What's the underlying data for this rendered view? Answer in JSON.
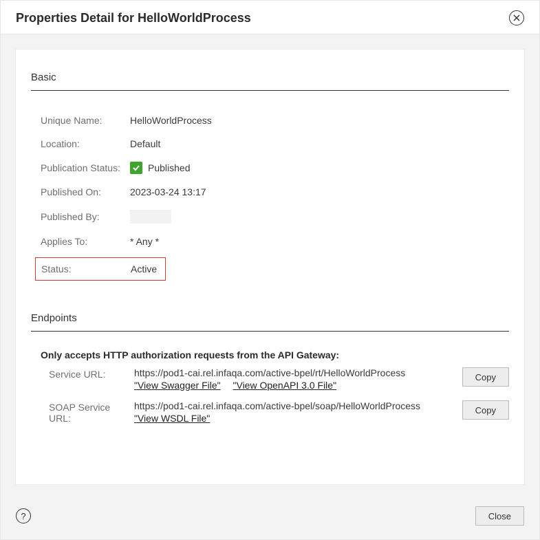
{
  "header": {
    "title": "Properties Detail for HelloWorldProcess"
  },
  "basic": {
    "section_title": "Basic",
    "unique_name_label": "Unique Name:",
    "unique_name_value": "HelloWorldProcess",
    "location_label": "Location:",
    "location_value": "Default",
    "pub_status_label": "Publication Status:",
    "pub_status_value": "Published",
    "published_on_label": "Published On:",
    "published_on_value": "2023-03-24 13:17",
    "published_by_label": "Published By:",
    "published_by_value": "",
    "applies_to_label": "Applies To:",
    "applies_to_value": "* Any *",
    "status_label": "Status:",
    "status_value": "Active"
  },
  "endpoints": {
    "section_title": "Endpoints",
    "note": "Only accepts HTTP authorization requests from the API Gateway:",
    "service_url_label": "Service URL:",
    "service_url_value": "https://pod1-cai.rel.infaqa.com/active-bpel/rt/HelloWorldProcess",
    "swagger_link": "\"View Swagger File\"",
    "openapi_link": "\"View OpenAPI 3.0 File\"",
    "soap_url_label": "SOAP Service URL:",
    "soap_url_value": "https://pod1-cai.rel.infaqa.com/active-bpel/soap/HelloWorldProcess",
    "wsdl_link": "\"View WSDL File\"",
    "copy_label": "Copy"
  },
  "footer": {
    "close_label": "Close",
    "help_glyph": "?"
  }
}
